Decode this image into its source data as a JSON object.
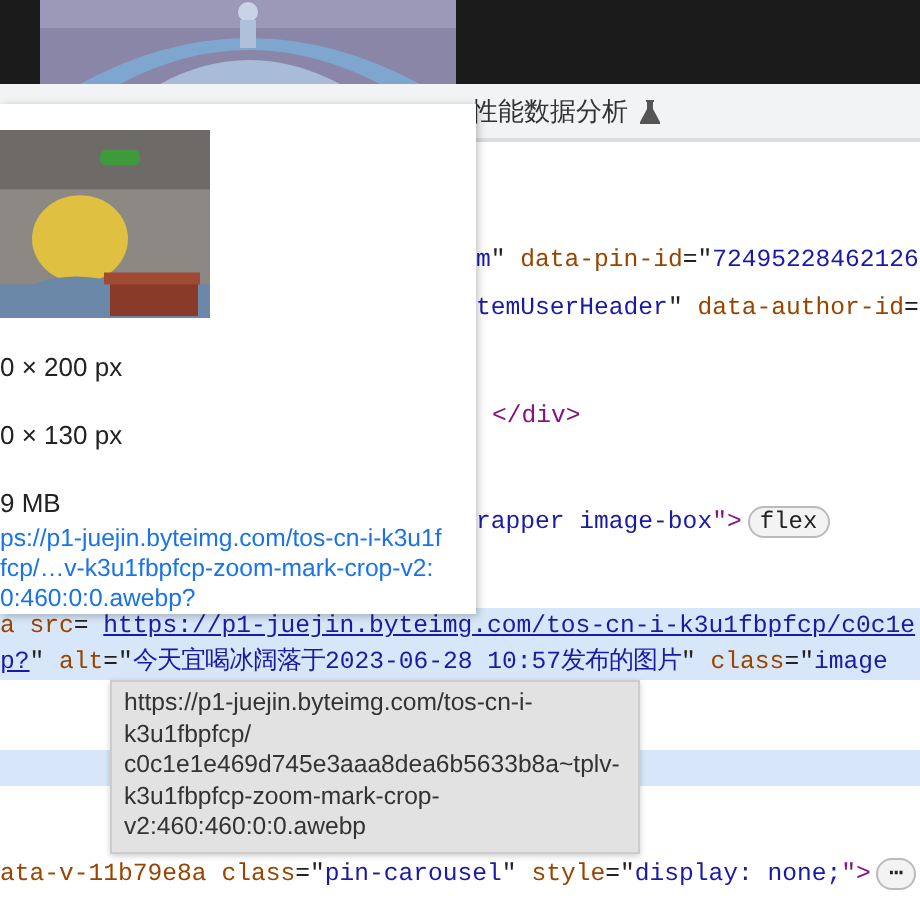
{
  "top_picture": {
    "kind": "picture"
  },
  "tab_bar": {
    "label": "性能数据分析"
  },
  "code_lines": [
    {
      "selected": false,
      "segments": [
        {
          "kind": "value",
          "text": "m"
        },
        {
          "kind": "punct",
          "text": "\" "
        },
        {
          "kind": "attr",
          "text": "data-pin-id"
        },
        {
          "kind": "punct",
          "text": "=\""
        },
        {
          "kind": "value",
          "text": "72495228462126"
        }
      ]
    },
    {
      "selected": false,
      "segments": [
        {
          "kind": "value",
          "text": "temUserHeader"
        },
        {
          "kind": "punct",
          "text": "\" "
        },
        {
          "kind": "attr",
          "text": "data-author-id"
        },
        {
          "kind": "punct",
          "text": "="
        }
      ]
    },
    {
      "selected": false,
      "segments": [
        {
          "kind": "tag",
          "text": "</div>"
        }
      ]
    },
    {
      "selected": false,
      "segments": [
        {
          "kind": "value",
          "text": "rapper image-box"
        },
        {
          "kind": "tag",
          "text": "\">"
        },
        {
          "kind": "badge",
          "text": "flex"
        }
      ]
    },
    {
      "selected": true,
      "segments": [
        {
          "kind": "attr",
          "text": "a src"
        },
        {
          "kind": "punct",
          "text": "= "
        },
        {
          "kind": "link",
          "text": "https://p1-juejin.byteimg.com/tos-cn-i-k3u1fbpfcp/c0c1e"
        }
      ]
    },
    {
      "selected": true,
      "segments": [
        {
          "kind": "link",
          "text": "p?"
        },
        {
          "kind": "punct",
          "text": "\" "
        },
        {
          "kind": "attr",
          "text": "alt"
        },
        {
          "kind": "punct",
          "text": "=\""
        },
        {
          "kind": "value",
          "text": "今天宜喝冰阔落于2023-06-28 10:57发布的图片"
        },
        {
          "kind": "punct",
          "text": "\" "
        },
        {
          "kind": "attr",
          "text": "class"
        },
        {
          "kind": "punct",
          "text": "=\""
        },
        {
          "kind": "value",
          "text": "image"
        }
      ]
    },
    {
      "selected": true
    },
    {
      "selected": false,
      "segments": [
        {
          "kind": "attr",
          "text": "ata-v-11b79e8a class"
        },
        {
          "kind": "punct",
          "text": "=\""
        },
        {
          "kind": "value",
          "text": "pin-carousel"
        },
        {
          "kind": "punct",
          "text": "\" "
        },
        {
          "kind": "attr",
          "text": "style"
        },
        {
          "kind": "punct",
          "text": "=\""
        },
        {
          "kind": "value",
          "text": "display: none;"
        },
        {
          "kind": "tag",
          "text": "\">"
        },
        {
          "kind": "badge",
          "text": "⋯"
        }
      ]
    }
  ],
  "image_popup": {
    "picture": {
      "kind": "picture"
    },
    "details": [
      "0 × 200 px",
      "0 × 130 px",
      "9 MB"
    ],
    "link_lines": [
      "ps://p1-juejin.byteimg.com/tos-cn-i-k3u1f",
      "fcp/…v-k3u1fbpfcp-zoom-mark-crop-v2:",
      "0:460:0:0.awebp?"
    ]
  },
  "tooltip": {
    "lines": [
      "https://p1-juejin.byteimg.com/tos-cn-i-",
      "k3u1fbpfcp/",
      "c0c1e1e469d745e3aaa8dea6b5633b8a~tplv-",
      "k3u1fbpfcp-zoom-mark-crop-",
      "v2:460:460:0:0.awebp"
    ]
  }
}
